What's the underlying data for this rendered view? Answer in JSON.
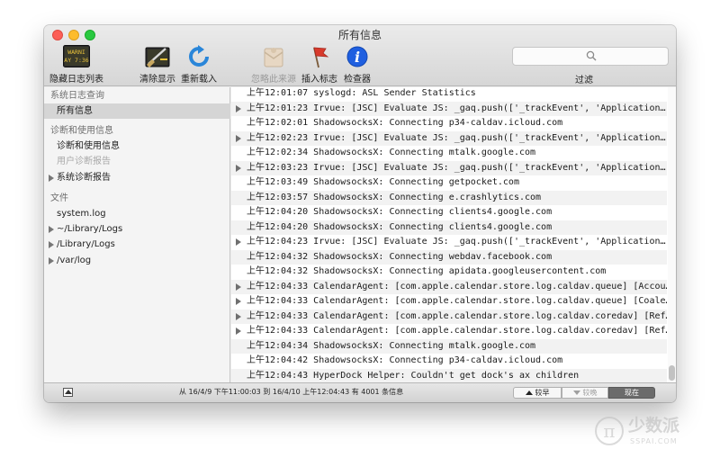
{
  "window": {
    "title": "所有信息"
  },
  "toolbar": {
    "hide_log_list": "隐藏日志列表",
    "clear_display": "清除显示",
    "reload": "重新载入",
    "ignore_sender": "忽略此来源",
    "insert_marker": "插入标志",
    "inspector": "检查器",
    "filter": "过滤",
    "hide_log_list_icon_text_1": "WARNI",
    "hide_log_list_icon_text_2": "AY 7:36"
  },
  "search": {
    "placeholder": ""
  },
  "sidebar": {
    "items": [
      {
        "label": "系统日志查询",
        "kind": "header"
      },
      {
        "label": "所有信息",
        "kind": "sub",
        "selected": true
      },
      {
        "label": "诊断和使用信息",
        "kind": "header"
      },
      {
        "label": "诊断和使用信息",
        "kind": "sub"
      },
      {
        "label": "用户诊断报告",
        "kind": "sub",
        "disabled": true
      },
      {
        "label": "系统诊断报告",
        "kind": "tri"
      },
      {
        "label": "文件",
        "kind": "header"
      },
      {
        "label": "system.log",
        "kind": "sub"
      },
      {
        "label": "~/Library/Logs",
        "kind": "tri"
      },
      {
        "label": "/Library/Logs",
        "kind": "tri"
      },
      {
        "label": "/var/log",
        "kind": "tri"
      }
    ]
  },
  "log": {
    "rows": [
      {
        "text": "上午12:01:07 syslogd: ASL Sender Statistics",
        "expandable": false
      },
      {
        "text": "上午12:01:23 Irvue: [JSC] Evaluate JS: _gaq.push(['_trackEvent', 'Application…",
        "expandable": true
      },
      {
        "text": "上午12:02:01 ShadowsocksX: Connecting p34-caldav.icloud.com",
        "expandable": false
      },
      {
        "text": "上午12:02:23 Irvue: [JSC] Evaluate JS: _gaq.push(['_trackEvent', 'Application…",
        "expandable": true
      },
      {
        "text": "上午12:02:34 ShadowsocksX: Connecting mtalk.google.com",
        "expandable": false
      },
      {
        "text": "上午12:03:23 Irvue: [JSC] Evaluate JS: _gaq.push(['_trackEvent', 'Application…",
        "expandable": true
      },
      {
        "text": "上午12:03:49 ShadowsocksX: Connecting getpocket.com",
        "expandable": false
      },
      {
        "text": "上午12:03:57 ShadowsocksX: Connecting e.crashlytics.com",
        "expandable": false
      },
      {
        "text": "上午12:04:20 ShadowsocksX: Connecting clients4.google.com",
        "expandable": false
      },
      {
        "text": "上午12:04:20 ShadowsocksX: Connecting clients4.google.com",
        "expandable": false
      },
      {
        "text": "上午12:04:23 Irvue: [JSC] Evaluate JS: _gaq.push(['_trackEvent', 'Application…",
        "expandable": true
      },
      {
        "text": "上午12:04:32 ShadowsocksX: Connecting webdav.facebook.com",
        "expandable": false
      },
      {
        "text": "上午12:04:32 ShadowsocksX: Connecting apidata.googleusercontent.com",
        "expandable": false
      },
      {
        "text": "上午12:04:33 CalendarAgent: [com.apple.calendar.store.log.caldav.queue] [Accou…",
        "expandable": true
      },
      {
        "text": "上午12:04:33 CalendarAgent: [com.apple.calendar.store.log.caldav.queue] [Coale…",
        "expandable": true
      },
      {
        "text": "上午12:04:33 CalendarAgent: [com.apple.calendar.store.log.caldav.coredav] [Ref…",
        "expandable": true
      },
      {
        "text": "上午12:04:33 CalendarAgent: [com.apple.calendar.store.log.caldav.coredav] [Ref…",
        "expandable": true
      },
      {
        "text": "上午12:04:34 ShadowsocksX: Connecting mtalk.google.com",
        "expandable": false
      },
      {
        "text": "上午12:04:42 ShadowsocksX: Connecting p34-caldav.icloud.com",
        "expandable": false
      },
      {
        "text": "上午12:04:43 HyperDock Helper: Couldn't get dock's ax children",
        "expandable": false
      }
    ]
  },
  "status": {
    "text": "从 16/4/9 下午11:00:03 到 16/4/10 上午12:04:43 有 4001 条信息",
    "earlier": "较早",
    "later": "较晚",
    "now": "现在"
  },
  "watermark": {
    "line1": "少数派",
    "line2": "SSPAI.COM"
  },
  "colors": {
    "close": "#fc5f57",
    "minimize": "#fdbc2e",
    "zoom": "#29c840",
    "info_blue": "#1f5fe0",
    "reload_blue": "#2a86d9"
  }
}
